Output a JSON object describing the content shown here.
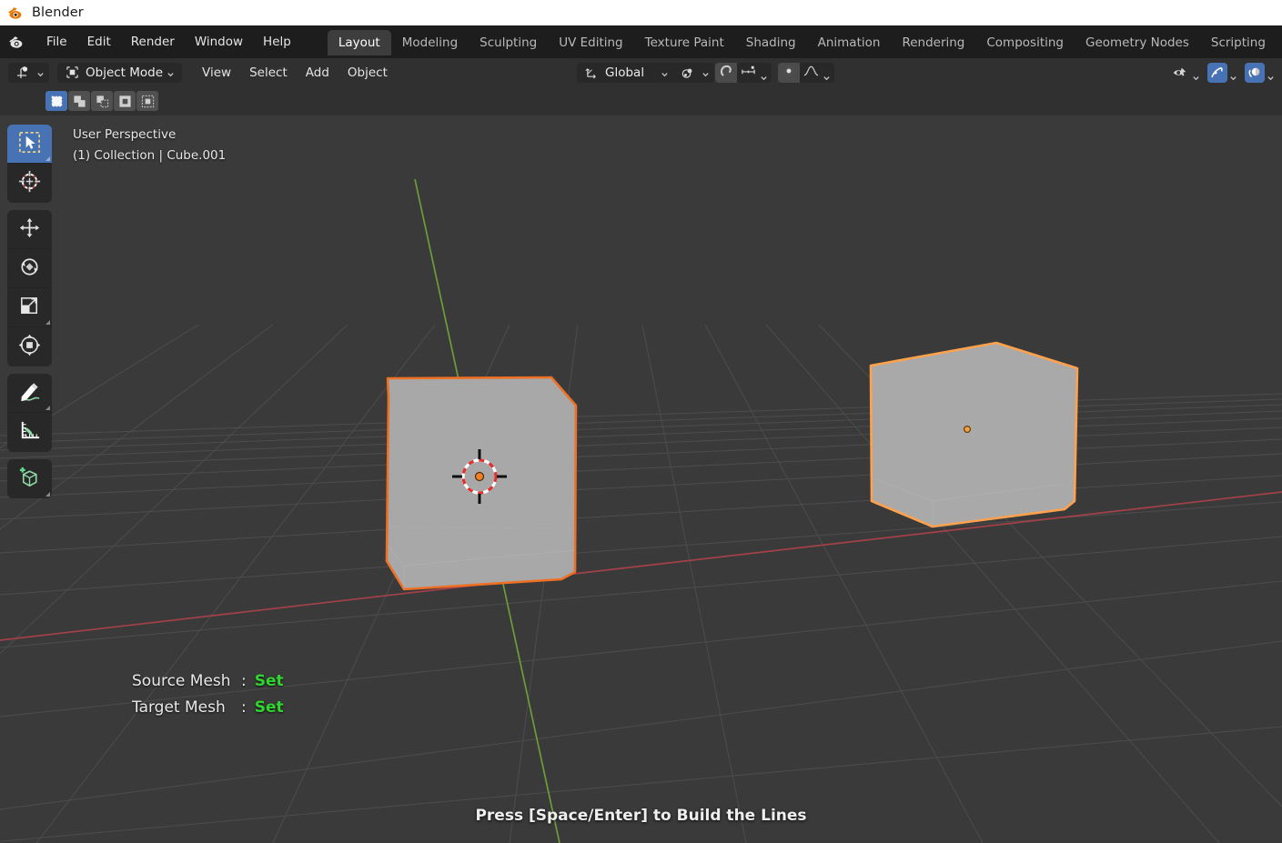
{
  "window": {
    "title": "Blender",
    "logo_icon": "blender-logo-icon"
  },
  "top_menu": {
    "items": [
      {
        "label": "File"
      },
      {
        "label": "Edit"
      },
      {
        "label": "Render"
      },
      {
        "label": "Window"
      },
      {
        "label": "Help"
      }
    ]
  },
  "workspace_tabs": {
    "active": "Layout",
    "items": [
      {
        "label": "Layout"
      },
      {
        "label": "Modeling"
      },
      {
        "label": "Sculpting"
      },
      {
        "label": "UV Editing"
      },
      {
        "label": "Texture Paint"
      },
      {
        "label": "Shading"
      },
      {
        "label": "Animation"
      },
      {
        "label": "Rendering"
      },
      {
        "label": "Compositing"
      },
      {
        "label": "Geometry Nodes"
      },
      {
        "label": "Scripting"
      }
    ],
    "add_label": "+"
  },
  "viewport_header": {
    "editor_type_icon": "editor-type-3d-viewport-icon",
    "mode": "Object Mode",
    "mode_icon": "object-mode-icon",
    "menus": [
      {
        "label": "View"
      },
      {
        "label": "Select"
      },
      {
        "label": "Add"
      },
      {
        "label": "Object"
      }
    ],
    "transform_orientation": "Global",
    "transform_orientation_icon": "orientation-axes-icon",
    "pivot_icon": "pivot-point-icon",
    "snap_icon": "snap-magnet-icon",
    "snap_target_icon": "snap-increment-icon",
    "proportional_icon": "proportional-editing-icon",
    "falloff_icon": "proportional-falloff-icon",
    "right_toggles": [
      {
        "name": "visibility-selectability-toggle",
        "active": false
      },
      {
        "name": "gizmo-toggle",
        "active": true
      },
      {
        "name": "overlays-toggle",
        "active": true
      }
    ]
  },
  "select_modes": {
    "items": [
      {
        "name": "select-set",
        "active": true
      },
      {
        "name": "select-extend",
        "active": false
      },
      {
        "name": "select-subtract",
        "active": false
      },
      {
        "name": "select-invert",
        "active": false
      },
      {
        "name": "select-intersect",
        "active": false
      }
    ]
  },
  "toolbar": {
    "items": [
      {
        "name": "tweak-select-box-tool",
        "icon": "cursor-arrow-select-box-icon",
        "active": true,
        "has_corner": true
      },
      {
        "name": "cursor-tool",
        "icon": "3d-cursor-icon",
        "active": false,
        "has_corner": false
      },
      {
        "name": "move-tool",
        "icon": "move-arrows-icon",
        "active": false,
        "has_corner": false
      },
      {
        "name": "rotate-tool",
        "icon": "rotate-circle-icon",
        "active": false,
        "has_corner": false
      },
      {
        "name": "scale-tool",
        "icon": "scale-square-icon",
        "active": false,
        "has_corner": true
      },
      {
        "name": "transform-tool",
        "icon": "transform-icon",
        "active": false,
        "has_corner": false
      },
      {
        "name": "annotate-tool",
        "icon": "annotate-pencil-icon",
        "active": false,
        "has_corner": true
      },
      {
        "name": "measure-tool",
        "icon": "measure-ruler-icon",
        "active": false,
        "has_corner": false
      },
      {
        "name": "add-cube-tool",
        "icon": "add-cube-icon",
        "active": false,
        "has_corner": true
      }
    ]
  },
  "viewport": {
    "perspective_label": "User Perspective",
    "collection_label": "(1) Collection | Cube.001",
    "hint_text": "Press [Space/Enter] to Build the Lines",
    "overlay_info": {
      "rows": [
        {
          "label": "Source Mesh",
          "colon": ":",
          "value": "Set"
        },
        {
          "label": "Target Mesh",
          "colon": ":",
          "value": "Set"
        }
      ]
    },
    "cursor_icon": "3d-cursor-icon",
    "objects": [
      {
        "name": "cube-left",
        "selected": true,
        "active": false
      },
      {
        "name": "cube-right",
        "selected": true,
        "active": true
      }
    ]
  },
  "colors": {
    "titlebar_bg": "#ffffff",
    "topbar_bg": "#1d1d1d",
    "header_bg": "#303030",
    "viewport_bg": "#3a3a3a",
    "grid_line": "#4b4b4b",
    "axis_x_red": "#a13f46",
    "axis_y_green": "#6f9c38",
    "accent_blue": "#4772b3",
    "mesh_gray": "#a8a8a8",
    "outline_selected": "#ed7024",
    "outline_active": "#ffa14d",
    "value_green": "#2fd62f",
    "tool_green": "#8fd9a8"
  }
}
